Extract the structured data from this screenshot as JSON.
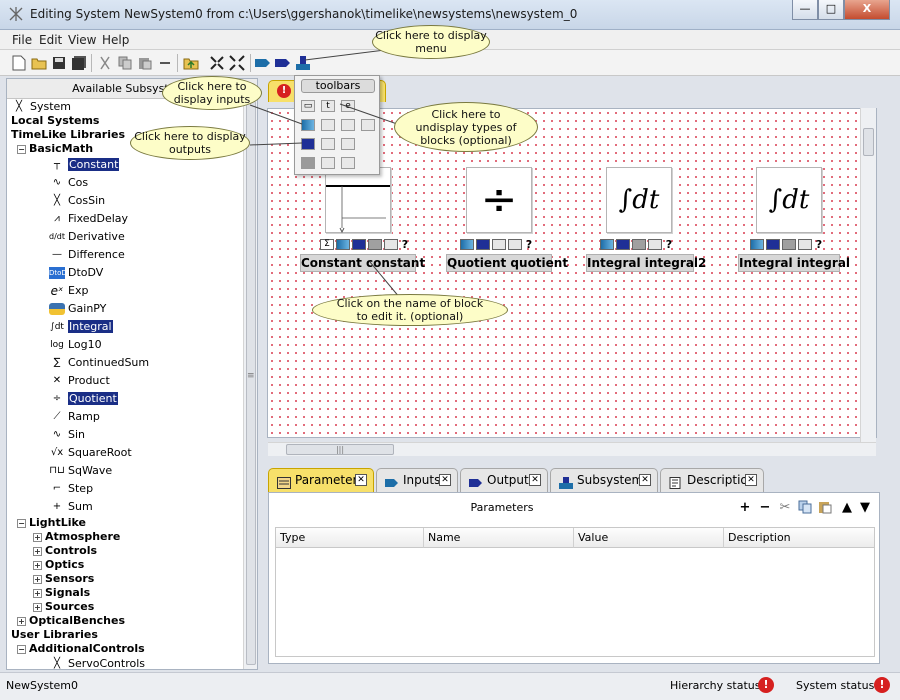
{
  "window": {
    "title": "Editing System NewSystem0 from c:\\Users\\ggershanok\\timelike\\newsystems\\newsystem_0",
    "controls": [
      "—",
      "□",
      "X"
    ]
  },
  "menu": [
    "File",
    "Edit",
    "View",
    "Help"
  ],
  "left_panel": {
    "header": "Available Subsystems",
    "tree": [
      {
        "label": "System",
        "kind": "root"
      },
      {
        "label": "Local Systems",
        "kind": "section"
      },
      {
        "label": "TimeLike Libraries",
        "kind": "section"
      },
      {
        "label": "BasicMath",
        "kind": "group"
      },
      {
        "label": "Constant",
        "selected": true
      },
      {
        "label": "Cos"
      },
      {
        "label": "CosSin"
      },
      {
        "label": "FixedDelay"
      },
      {
        "label": "Derivative"
      },
      {
        "label": "Difference"
      },
      {
        "label": "DtoDV"
      },
      {
        "label": "Exp"
      },
      {
        "label": "GainPY"
      },
      {
        "label": "Integral",
        "selected": true
      },
      {
        "label": "Log10"
      },
      {
        "label": "ContinuedSum"
      },
      {
        "label": "Product"
      },
      {
        "label": "Quotient",
        "selected": true
      },
      {
        "label": "Ramp"
      },
      {
        "label": "Sin"
      },
      {
        "label": "SquareRoot"
      },
      {
        "label": "SqWave"
      },
      {
        "label": "Step"
      },
      {
        "label": "Sum"
      },
      {
        "label": "LightLike",
        "kind": "group"
      },
      {
        "label": "Atmosphere",
        "kind": "sub"
      },
      {
        "label": "Controls",
        "kind": "sub"
      },
      {
        "label": "Optics",
        "kind": "sub"
      },
      {
        "label": "Sensors",
        "kind": "sub"
      },
      {
        "label": "Signals",
        "kind": "sub"
      },
      {
        "label": "Sources",
        "kind": "sub"
      },
      {
        "label": "OpticalBenches",
        "kind": "group"
      },
      {
        "label": "User Libraries",
        "kind": "section"
      },
      {
        "label": "AdditionalControls",
        "kind": "group"
      },
      {
        "label": "ServoControls"
      }
    ]
  },
  "popup": {
    "title": "toolbars"
  },
  "blocks": [
    {
      "name": "Constant constant"
    },
    {
      "name": "Quotient quotient"
    },
    {
      "name": "Integral integral2"
    },
    {
      "name": "Integral integral"
    }
  ],
  "block_symbols": {
    "quotient": "÷",
    "integral": "∫dt"
  },
  "callouts": {
    "menu": "Click here to display menu",
    "inputs": "Click here to display inputs",
    "outputs": "Click here to display outputs",
    "undisplay": "Click here to undisplay types of blocks (optional)",
    "edit_name": "Click on the name of block to edit it. (optional)"
  },
  "bottom_tabs": [
    "Parameters",
    "Inputs",
    "Outputs",
    "Subsystems",
    "Description"
  ],
  "parameters": {
    "title": "Parameters",
    "columns": [
      "Type",
      "Name",
      "Value",
      "Description"
    ]
  },
  "status": {
    "system_name": "NewSystem0",
    "hierarchy_label": "Hierarchy status:",
    "system_label": "System status:"
  },
  "colors": {
    "accent_tab": "#f7e06a",
    "selection": "#1a2e86",
    "error": "#d62020",
    "callout": "#fdfdc8"
  }
}
